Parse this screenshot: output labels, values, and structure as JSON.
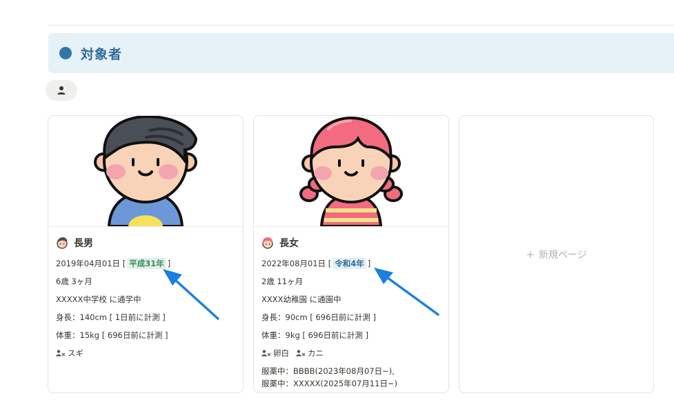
{
  "section": {
    "title": "対象者"
  },
  "cards": [
    {
      "name": "長男",
      "birth_date": "2019年04月01日",
      "era": "平成31年",
      "age": "6歳 3ヶ月",
      "school": "XXXXX中学校 に通学中",
      "height": "身長：140cm [ 1日前に計測 ]",
      "weight": "体重：15kg [ 696日前に計測 ]",
      "allergies": [
        "スギ"
      ]
    },
    {
      "name": "長女",
      "birth_date": "2022年08月01日",
      "era": "令和4年",
      "age": "2歳 11ヶ月",
      "school": "XXXX幼稚園 に通園中",
      "height": "身長：90cm [ 696日前に計測 ]",
      "weight": "体重：9kg [ 696日前に計測 ]",
      "allergies": [
        "卵白",
        "カニ"
      ],
      "medications": [
        "服薬中：BBBB(2023年08月07日~),",
        "服薬中：XXXXX(2025年07月11日~)"
      ]
    }
  ],
  "new_page_label": "新規ページ",
  "colors": {
    "accent": "#2f78a8",
    "heading_bg": "#e7f1f8",
    "arrow": "#1a7fe0",
    "era_green": "#3d8a5f",
    "era_blue": "#2f6c99"
  }
}
